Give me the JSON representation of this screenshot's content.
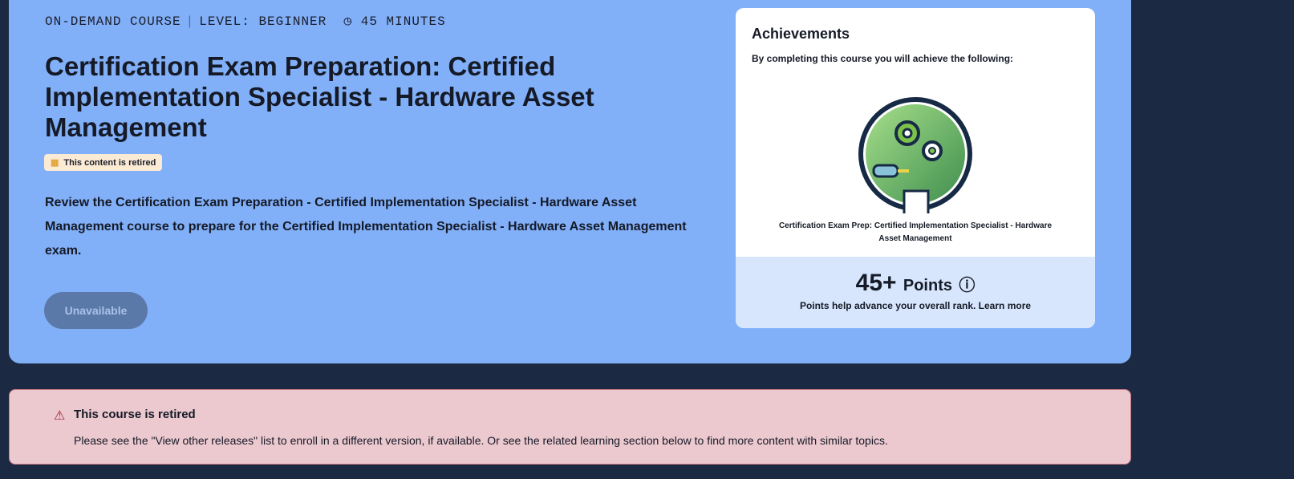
{
  "meta": {
    "type": "ON-DEMAND COURSE",
    "level": "LEVEL: BEGINNER",
    "duration": "45 MINUTES"
  },
  "title": "Certification Exam Preparation: Certified Implementation Specialist - Hardware Asset Management",
  "badge": "This content is retired",
  "description": "Review the Certification Exam Preparation - Certified Implementation Specialist - Hardware Asset Management course to prepare for the Certified Implementation Specialist - Hardware Asset Management exam.",
  "button": "Unavailable",
  "achievements": {
    "heading": "Achievements",
    "subtitle": "By completing this course you will achieve the following:",
    "caption": "Certification Exam Prep: Certified Implementation Specialist - Hardware Asset Management",
    "points": "45+",
    "points_label": "Points",
    "note": "Points help advance your overall rank. Learn more"
  },
  "alert": {
    "title": "This course is retired",
    "body": "Please see the \"View other releases\" list to enroll in a different version, if available. Or see the related learning section below to find more content with similar topics."
  }
}
